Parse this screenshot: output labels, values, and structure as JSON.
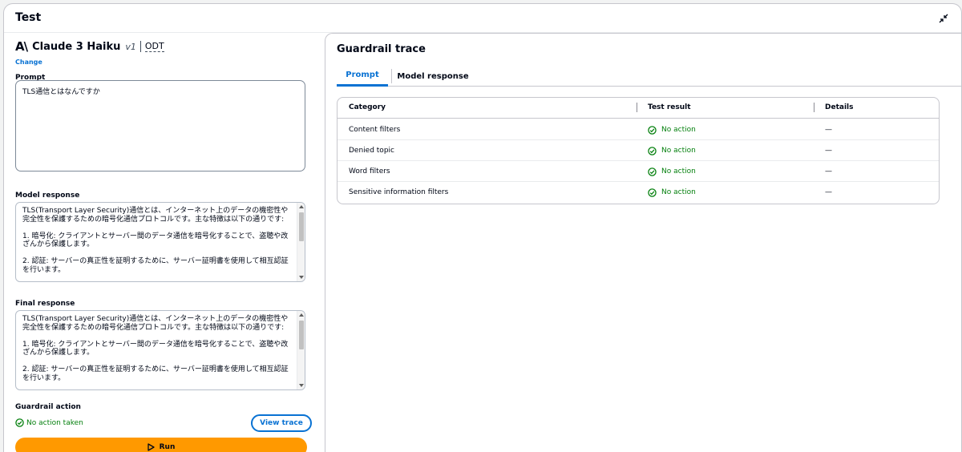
{
  "panel": {
    "title": "Test"
  },
  "model": {
    "logo": "A\\",
    "name": "Claude 3 Haiku",
    "version": "v1",
    "tag": "ODT",
    "change_label": "Change"
  },
  "prompt": {
    "label": "Prompt",
    "value": "TLS通信とはなんですか"
  },
  "model_response": {
    "label": "Model response",
    "text": "TLS(Transport Layer Security)通信とは、インターネット上のデータの機密性や完全性を保護するための暗号化通信プロトコルです。主な特徴は以下の通りです:\n\n1. 暗号化: クライアントとサーバー間のデータ通信を暗号化することで、盗聴や改ざんから保護します。\n\n2. 認証: サーバーの真正性を証明するために、サーバー証明書を使用して相互認証を行います。"
  },
  "final_response": {
    "label": "Final response",
    "text": "TLS(Transport Layer Security)通信とは、インターネット上のデータの機密性や完全性を保護するための暗号化通信プロトコルです。主な特徴は以下の通りです:\n\n1. 暗号化: クライアントとサーバー間のデータ通信を暗号化することで、盗聴や改ざんから保護します。\n\n2. 認証: サーバーの真正性を証明するために、サーバー証明書を使用して相互認証を行います。"
  },
  "guardrail_action": {
    "label": "Guardrail action",
    "status": "No action taken",
    "view_trace_label": "View trace"
  },
  "run_label": "Run",
  "trace": {
    "title": "Guardrail trace",
    "tabs": [
      {
        "label": "Prompt",
        "active": true
      },
      {
        "label": "Model response",
        "active": false
      }
    ],
    "columns": [
      "Category",
      "Test result",
      "Details"
    ],
    "rows": [
      {
        "category": "Content filters",
        "result": "No action",
        "details": "—"
      },
      {
        "category": "Denied topic",
        "result": "No action",
        "details": "—"
      },
      {
        "category": "Word filters",
        "result": "No action",
        "details": "—"
      },
      {
        "category": "Sensitive information filters",
        "result": "No action",
        "details": "—"
      }
    ]
  },
  "colors": {
    "accent": "#0972d3",
    "success": "#037f0c",
    "run_button": "#ff9900",
    "border": "#c6c6cd"
  },
  "icons": {
    "collapse": "collapse-icon",
    "check": "check-circle-icon",
    "play": "play-icon"
  }
}
